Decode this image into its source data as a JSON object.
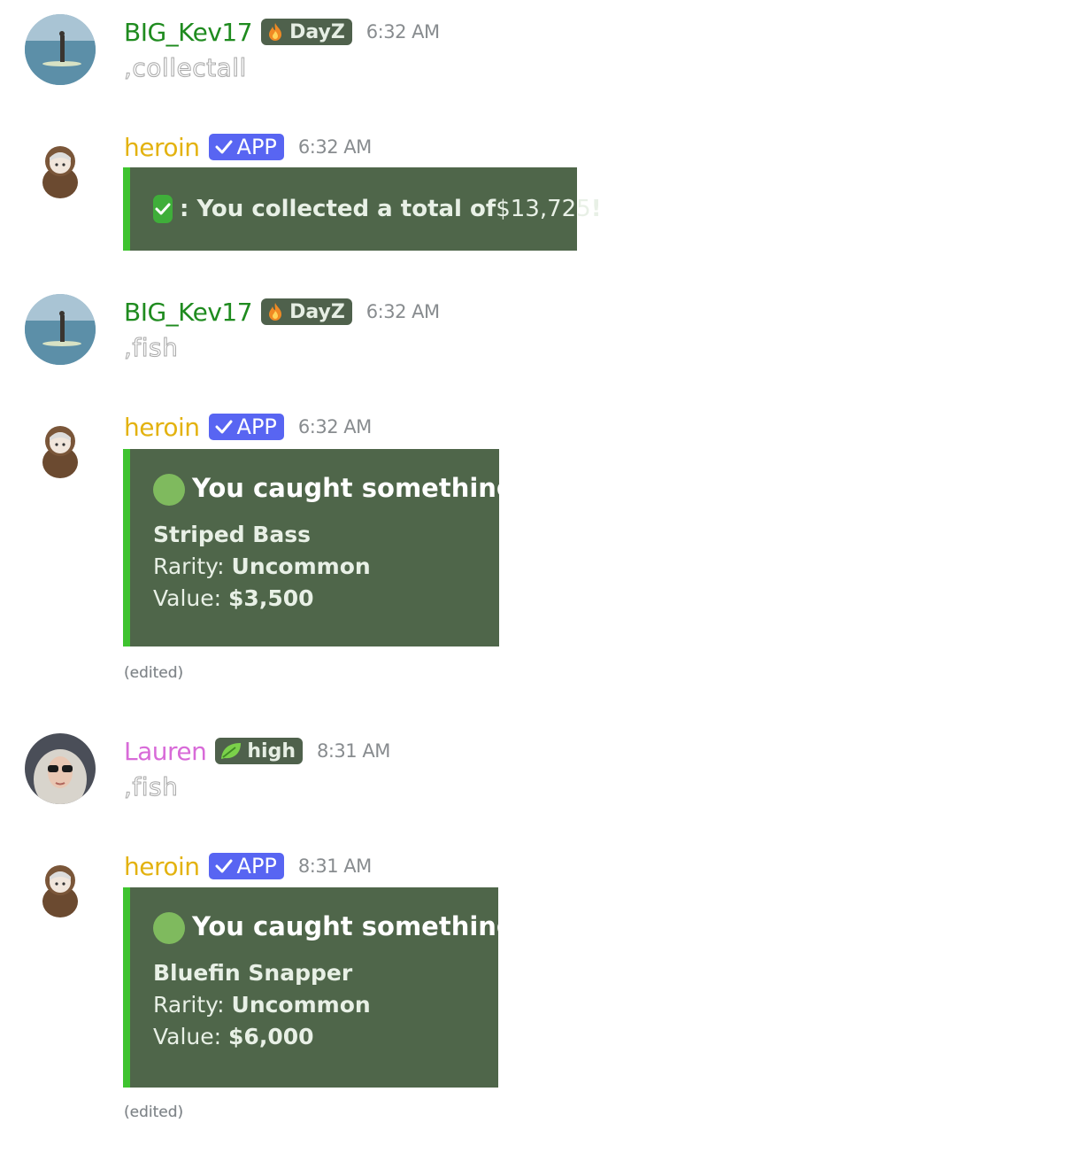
{
  "messages": [
    {
      "author": "BIG_Kev17",
      "role": "DayZ",
      "role_icon": "fire-icon",
      "time": "6:32 AM",
      "text": ",collectall"
    },
    {
      "author": "heroin",
      "badge": "APP",
      "time": "6:32 AM",
      "embed": {
        "prefix": ": You collected a total of ",
        "amount": "$13,725",
        "suffix": "!",
        "accent": "#3ec32f"
      }
    },
    {
      "author": "BIG_Kev17",
      "role": "DayZ",
      "role_icon": "fire-icon",
      "time": "6:32 AM",
      "text": ",fish"
    },
    {
      "author": "heroin",
      "badge": "APP",
      "time": "6:32 AM",
      "embed": {
        "title": "You caught something!",
        "fish": "Striped Bass",
        "rarity_label": "Rarity: ",
        "rarity": "Uncommon",
        "value_label": "Value: ",
        "value": "$3,500"
      },
      "edited": "(edited)"
    },
    {
      "author": "Lauren",
      "role": "high",
      "role_icon": "leaf-icon",
      "time": "8:31 AM",
      "text": ",fish"
    },
    {
      "author": "heroin",
      "badge": "APP",
      "time": "8:31 AM",
      "embed": {
        "title": "You caught something!",
        "fish": "Bluefin Snapper",
        "rarity_label": "Rarity: ",
        "rarity": "Uncommon",
        "value_label": "Value: ",
        "value": "$6,000"
      },
      "edited": "(edited)"
    }
  ],
  "colors": {
    "author_kev": "#1f8b1f",
    "author_heroin": "#e3b20f",
    "author_lauren": "#d86bd8",
    "app_badge": "#5865f2",
    "embed_bg": "#4f664a",
    "embed_accent": "#3ec32f"
  }
}
